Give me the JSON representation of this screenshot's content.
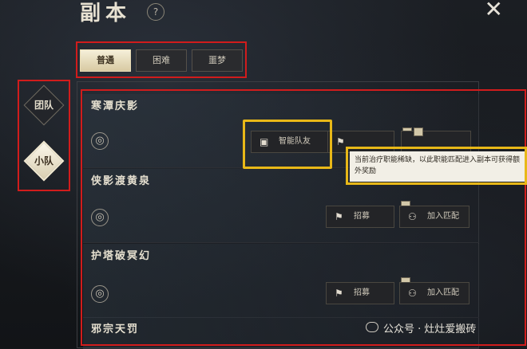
{
  "header": {
    "title": "副本",
    "help_label": "?",
    "close_label": "✕"
  },
  "difficulty_tabs": [
    {
      "label": "普通",
      "active": true
    },
    {
      "label": "困难",
      "active": false
    },
    {
      "label": "噩梦",
      "active": false
    }
  ],
  "team_modes": [
    {
      "label": "团队",
      "active": false
    },
    {
      "label": "小队",
      "active": true
    }
  ],
  "dungeons": [
    {
      "name": "寒潭庆影",
      "smart_team_label": "智能队友"
    },
    {
      "name": "侠影渡黄泉",
      "recruit_label": "招募",
      "join_label": "加入匹配"
    },
    {
      "name": "护塔破冥幻",
      "recruit_label": "招募",
      "join_label": "加入匹配"
    },
    {
      "name": "邪宗天罚"
    }
  ],
  "tooltip": {
    "text": "当前治疗职能稀缺，以此职能匹配进入副本可获得额外奖励"
  },
  "watermark": {
    "text": "公众号 · 灶灶爱搬砖"
  },
  "colors": {
    "annotation_red": "#d11c1c",
    "annotation_yellow": "#e8b818"
  }
}
